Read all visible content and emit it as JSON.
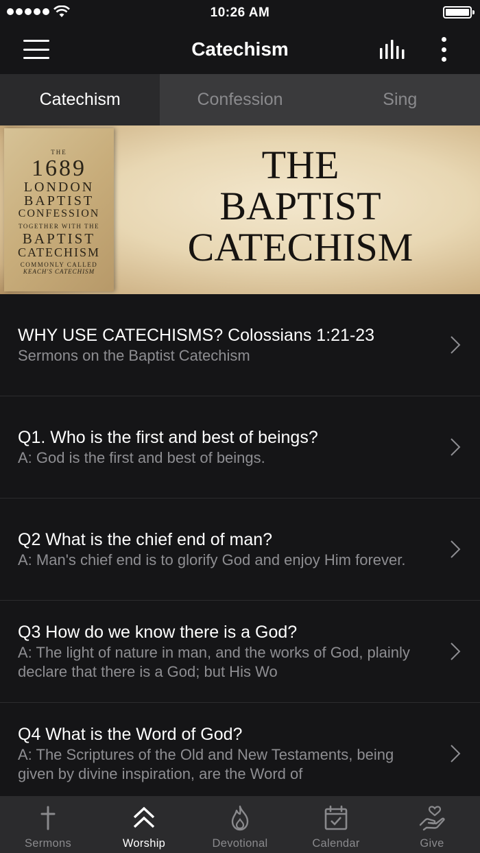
{
  "status_bar": {
    "time": "10:26 AM"
  },
  "nav": {
    "title": "Catechism"
  },
  "tabs": [
    {
      "label": "Catechism",
      "active": true
    },
    {
      "label": "Confession",
      "active": false
    },
    {
      "label": "Sing",
      "active": false
    }
  ],
  "banner": {
    "book": {
      "the": "THE",
      "year": "1689",
      "line1": "LONDON",
      "line2": "BAPTIST",
      "line3": "CONFESSION",
      "line4": "TOGETHER WITH THE",
      "line5": "BAPTIST",
      "line6": "CATECHISM",
      "line7": "COMMONLY CALLED",
      "line8": "KEACH'S CATECHISM"
    },
    "title_line1": "THE",
    "title_line2": "BAPTIST",
    "title_line3": "CATECHISM"
  },
  "items": [
    {
      "title": "WHY USE CATECHISMS? Colossians 1:21-23",
      "subtitle": "Sermons on the Baptist Catechism"
    },
    {
      "title": "Q1. Who is the first and best of beings?",
      "subtitle": "A: God is the first and best of beings."
    },
    {
      "title": "Q2 What is the chief end of man?",
      "subtitle": "A: Man's chief end is to glorify God and enjoy Him forever."
    },
    {
      "title": "Q3 How do we know there is a God?",
      "subtitle": "A: The light of nature in man, and the works of God, plainly declare that there is a God; but His Wo"
    },
    {
      "title": "Q4 What is the Word of God?",
      "subtitle": "A: The Scriptures of the Old and New Testaments, being given by divine inspiration, are the Word of"
    }
  ],
  "tabbar": [
    {
      "label": "Sermons",
      "icon": "cross-icon",
      "active": false
    },
    {
      "label": "Worship",
      "icon": "double-chevron-up-icon",
      "active": true
    },
    {
      "label": "Devotional",
      "icon": "flame-icon",
      "active": false
    },
    {
      "label": "Calendar",
      "icon": "calendar-check-icon",
      "active": false
    },
    {
      "label": "Give",
      "icon": "hand-heart-icon",
      "active": false
    }
  ],
  "colors": {
    "background": "#151517",
    "tab_bar": "#2b2b2d",
    "inactive": "#8a8a8d",
    "subtitle": "#8e8e92"
  }
}
